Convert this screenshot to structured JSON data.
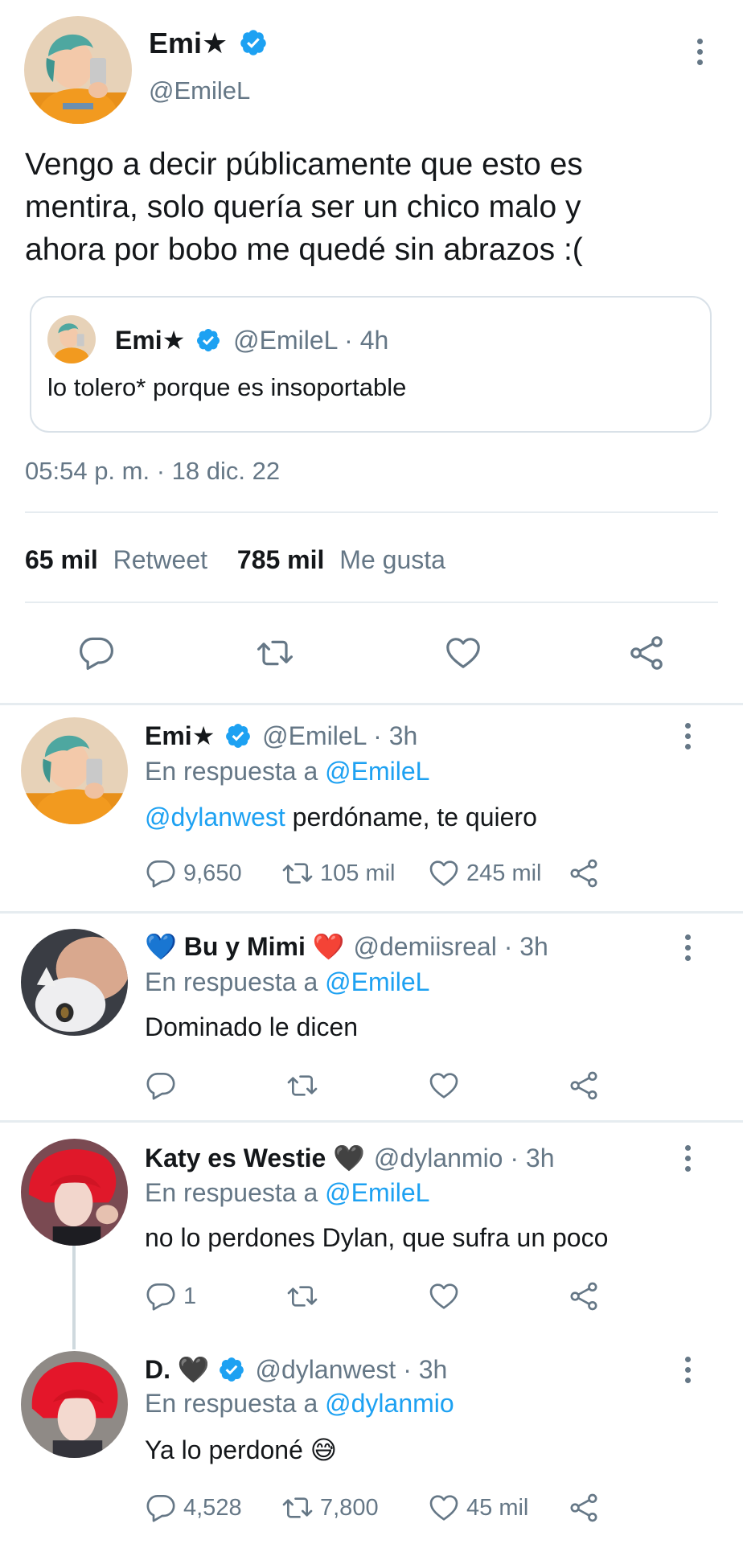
{
  "main_tweet": {
    "name": "Emi★",
    "handle": "@EmileL",
    "text_lines": [
      "Vengo a decir públicamente que esto es",
      "mentira, solo quería ser un chico malo y",
      "ahora por bobo me quedé sin abrazos :("
    ],
    "quoted": {
      "name": "Emi★",
      "handle": "@EmileL",
      "time": "· 4h",
      "text": "lo tolero* porque es insoportable"
    },
    "timestamp": "05:54 p. m. · 18 dic. 22",
    "stats": {
      "retweets_count": "65 mil",
      "retweets_label": "Retweet",
      "likes_count": "785 mil",
      "likes_label": "Me gusta"
    }
  },
  "replies": [
    {
      "name": "Emi★",
      "verified": true,
      "handle": "@EmileL",
      "time": "· 3h",
      "reply_prefix": "En respuesta a",
      "reply_to": "@EmileL",
      "mention": "@dylanwest",
      "text": "perdóname, te quiero",
      "replies_count": "9,650",
      "retweets_count": "105 mil",
      "likes_count": "245 mil"
    },
    {
      "emoji_before": "💙",
      "name": "Bu y Mimi",
      "emoji_after": "❤️",
      "handle": "@demiisreal",
      "time": "· 3h",
      "reply_prefix": "En respuesta a",
      "reply_to": "@EmileL",
      "text": "Dominado le dicen"
    },
    {
      "name": "Katy es Westie",
      "emoji_after": "🖤",
      "handle": "@dylanmio",
      "time": "· 3h",
      "reply_prefix": "En respuesta a",
      "reply_to": "@EmileL",
      "text": "no lo perdones Dylan, que sufra un poco",
      "replies_count": "1"
    },
    {
      "name": "D.",
      "emoji_after": "🖤",
      "verified": true,
      "handle": "@dylanwest",
      "time": "· 3h",
      "reply_prefix": "En respuesta a",
      "reply_to": "@dylanmio",
      "text": "Ya lo perdoné",
      "text_emoji": "😅",
      "replies_count": "4,528",
      "retweets_count": "7,800",
      "likes_count": "45 mil"
    }
  ],
  "icons": [
    "verified-badge-icon",
    "more-options-icon",
    "reply-icon",
    "retweet-icon",
    "like-icon",
    "share-icon"
  ],
  "colors": {
    "accent": "#1da1f2",
    "muted": "#657786",
    "text": "#14171a",
    "divider": "#e6ecf0"
  }
}
